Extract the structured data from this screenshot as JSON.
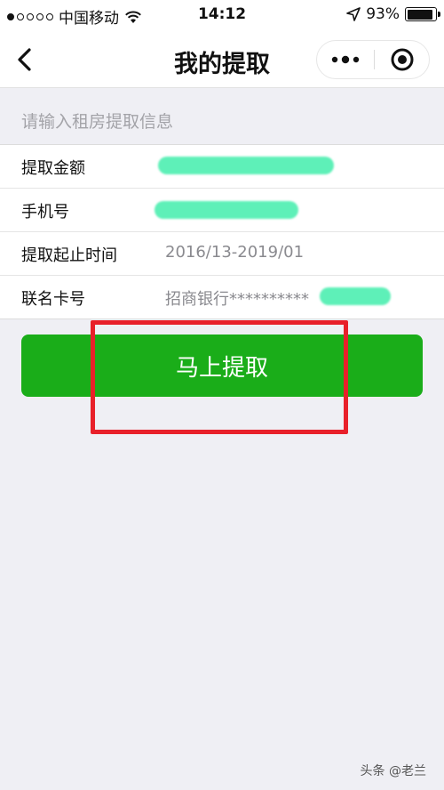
{
  "status_bar": {
    "carrier": "中国移动",
    "time": "14:12",
    "battery_percent": "93%",
    "battery_level": 0.93,
    "signal_bars_filled": 1,
    "signal_bars_total": 5
  },
  "navbar": {
    "back_icon": "chevron-left-icon",
    "title": "我的提取",
    "more_icon": "more-dots-icon",
    "close_icon": "target-circle-icon"
  },
  "form": {
    "hint": "请输入租房提取信息",
    "rows": [
      {
        "label": "提取金额",
        "value": ""
      },
      {
        "label": "手机号",
        "value": ""
      },
      {
        "label": "提取起止时间",
        "value": "2016/13-2019/01"
      },
      {
        "label": "联名卡号",
        "value": "招商银行**********"
      }
    ]
  },
  "action": {
    "submit_label": "马上提取"
  },
  "watermark": "头条 @老兰",
  "colors": {
    "accent_green": "#1aad19",
    "highlight_red": "#e8202a",
    "redaction": "#5ef0b8",
    "background": "#efeff4"
  }
}
